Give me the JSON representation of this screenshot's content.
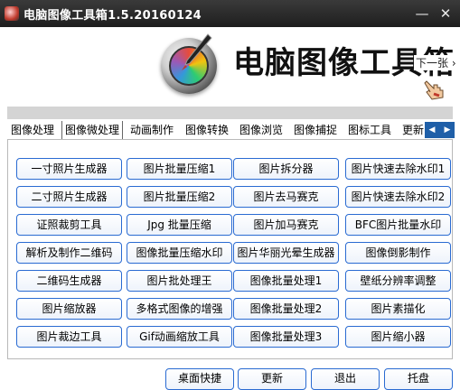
{
  "titlebar": {
    "title": "电脑图像工具箱1.5.20160124",
    "minimize_glyph": "—",
    "close_glyph": "✕"
  },
  "banner": {
    "big_title": "电脑图像工具箱",
    "next_link": "下一张 ›"
  },
  "tabs": [
    {
      "label": "图像处理",
      "active": false
    },
    {
      "label": "图像微处理",
      "active": true
    },
    {
      "label": "动画制作",
      "active": false
    },
    {
      "label": "图像转换",
      "active": false
    },
    {
      "label": "图像浏览",
      "active": false
    },
    {
      "label": "图像捕捉",
      "active": false
    },
    {
      "label": "图标工具",
      "active": false
    },
    {
      "label": "更新",
      "active": false
    }
  ],
  "tab_scroll": {
    "left": "◀",
    "right": "▶"
  },
  "features": [
    [
      "一寸照片生成器",
      "图片批量压缩1",
      "图片拆分器",
      "图片快速去除水印1"
    ],
    [
      "二寸照片生成器",
      "图片批量压缩2",
      "图片去马赛克",
      "图片快速去除水印2"
    ],
    [
      "证照裁剪工具",
      "Jpg 批量压缩",
      "图片加马赛克",
      "BFC图片批量水印"
    ],
    [
      "解析及制作二维码",
      "图像批量压缩水印",
      "图片华丽光晕生成器",
      "图像倒影制作"
    ],
    [
      "二维码生成器",
      "图片批处理王",
      "图像批量处理1",
      "壁纸分辨率调整"
    ],
    [
      "图片缩放器",
      "多格式图像的增强",
      "图像批量处理2",
      "图片素描化"
    ],
    [
      "图片裁边工具",
      "Gif动画缩放工具",
      "图像批量处理3",
      "图片缩小器"
    ]
  ],
  "bottom_buttons": [
    "桌面快捷",
    "更新",
    "退出",
    "托盘"
  ],
  "colors": {
    "accent": "#2a6bd2",
    "titlebar": "#2a2a2a",
    "tab_arrows": "#1f5fa8"
  }
}
